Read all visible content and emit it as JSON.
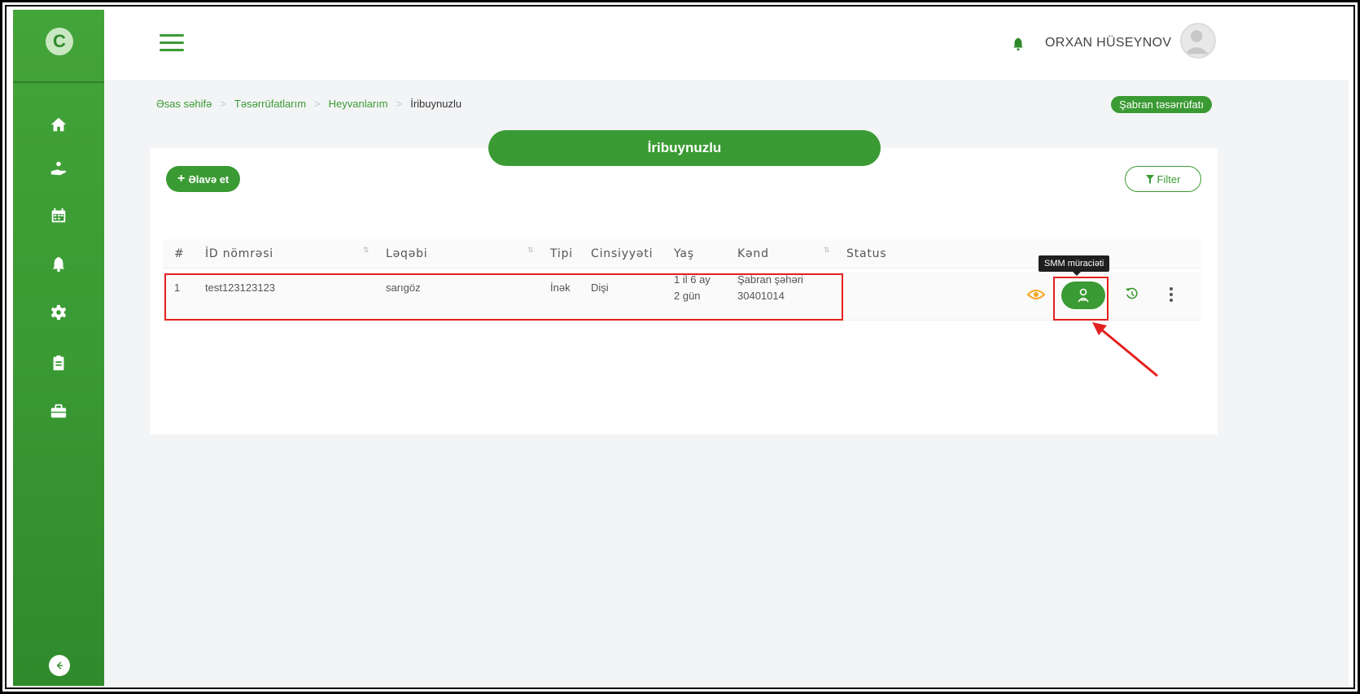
{
  "header": {
    "user_name": "ORXAN HÜSEYNOV"
  },
  "sidebar": {
    "logo": "C",
    "items": [
      {
        "icon": "home-icon"
      },
      {
        "icon": "hand-holding-icon"
      },
      {
        "icon": "calendar-icon"
      },
      {
        "icon": "bell-icon"
      },
      {
        "icon": "gear-icon"
      },
      {
        "icon": "clipboard-icon"
      },
      {
        "icon": "briefcase-icon"
      }
    ],
    "collapse_icon": "arrow-left-icon"
  },
  "breadcrumb": {
    "items": [
      "Əsas səhifə",
      "Təsərrüfatlarım",
      "Heyvanlarım"
    ],
    "current": "İribuynuzlu",
    "separator": ">"
  },
  "farm_badge": "Şabran təsərrüfatı",
  "page_title": "İribuynuzlu",
  "toolbar": {
    "add_label": "Əlavə et",
    "filter_label": "Filter"
  },
  "table": {
    "headers": [
      "#",
      "İD nömrəsi",
      "Ləqəbi",
      "Tipi",
      "Cinsiyyəti",
      "Yaş",
      "Kənd",
      "Status"
    ],
    "rows": [
      {
        "num": "1",
        "id": "test123123123",
        "nickname": "sarıgöz",
        "type": "İnək",
        "gender": "Dişi",
        "age_line1": "1 il 6 ay",
        "age_line2": "2 gün",
        "village_line1": "Şabran şəhəri",
        "village_line2": "30401014",
        "status": ""
      }
    ]
  },
  "tooltip": "SMM müraciəti",
  "colors": {
    "primary": "#3a9a33",
    "highlight": "#e3211f",
    "eye": "#f5a623"
  }
}
